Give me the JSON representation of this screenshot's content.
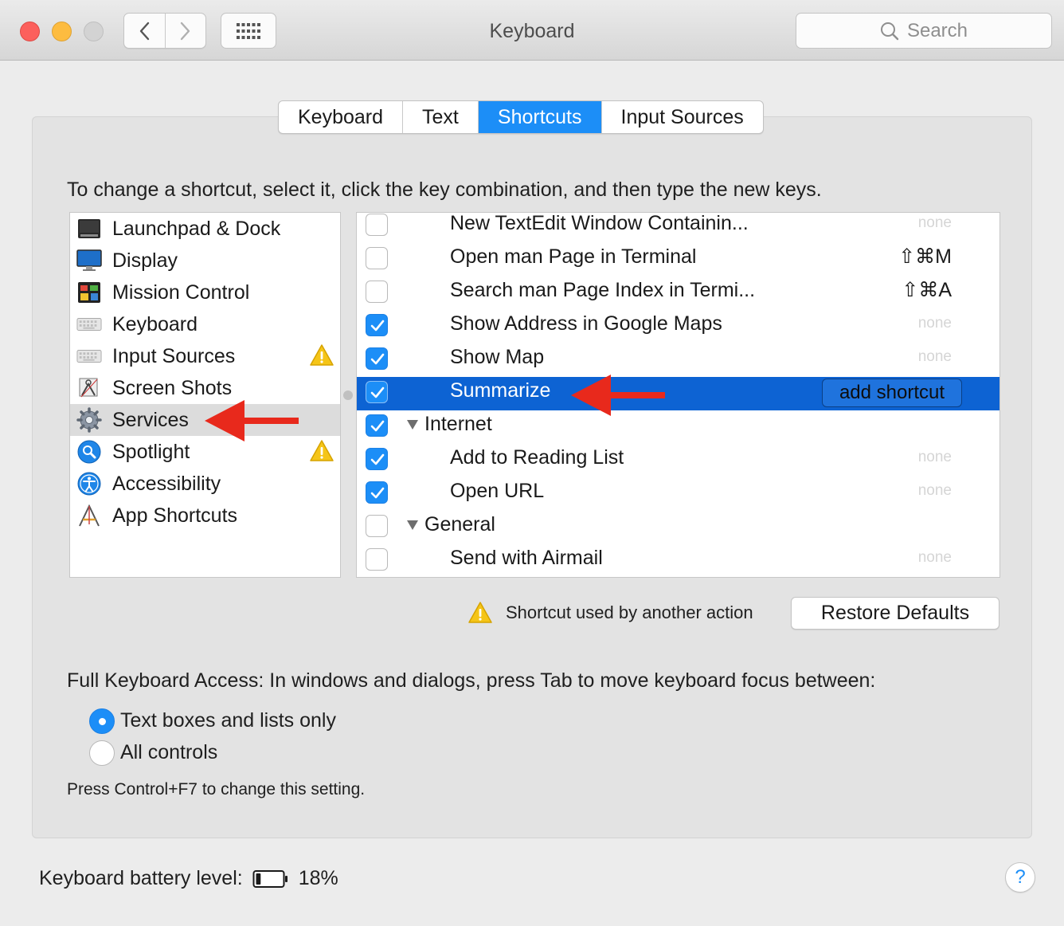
{
  "window": {
    "title": "Keyboard",
    "search_placeholder": "Search"
  },
  "tabs": [
    {
      "label": "Keyboard",
      "active": false
    },
    {
      "label": "Text",
      "active": false
    },
    {
      "label": "Shortcuts",
      "active": true
    },
    {
      "label": "Input Sources",
      "active": false
    }
  ],
  "instructions": "To change a shortcut, select it, click the key combination, and then type the new keys.",
  "categories": [
    {
      "label": "Launchpad & Dock",
      "icon": "launchpad-dock-icon"
    },
    {
      "label": "Display",
      "icon": "display-icon"
    },
    {
      "label": "Mission Control",
      "icon": "mission-control-icon"
    },
    {
      "label": "Keyboard",
      "icon": "keyboard-icon"
    },
    {
      "label": "Input Sources",
      "icon": "input-sources-icon",
      "warning": true
    },
    {
      "label": "Screen Shots",
      "icon": "screen-shots-icon"
    },
    {
      "label": "Services",
      "icon": "gear-icon",
      "selected": true
    },
    {
      "label": "Spotlight",
      "icon": "spotlight-icon",
      "warning": true
    },
    {
      "label": "Accessibility",
      "icon": "accessibility-icon"
    },
    {
      "label": "App Shortcuts",
      "icon": "app-shortcuts-icon"
    }
  ],
  "shortcuts": [
    {
      "label": "New TextEdit Window Containin...",
      "checked": false,
      "keys": "none"
    },
    {
      "label": "Open man Page in Terminal",
      "checked": false,
      "keys": "⇧⌘M"
    },
    {
      "label": "Search man Page Index in Termi...",
      "checked": false,
      "keys": "⇧⌘A"
    },
    {
      "label": "Show Address in Google Maps",
      "checked": true,
      "keys": "none"
    },
    {
      "label": "Show Map",
      "checked": true,
      "keys": "none"
    },
    {
      "label": "Summarize",
      "checked": true,
      "selected": true,
      "keys_button": "add shortcut"
    },
    {
      "label": "Internet",
      "checked": true,
      "group": true
    },
    {
      "label": "Add to Reading List",
      "checked": true,
      "keys": "none"
    },
    {
      "label": "Open URL",
      "checked": true,
      "keys": "none"
    },
    {
      "label": "General",
      "checked": false,
      "group": true
    },
    {
      "label": "Send with Airmail",
      "checked": false,
      "keys": "none"
    }
  ],
  "warning_note": "Shortcut used by another action",
  "restore_defaults": "Restore Defaults",
  "full_keyboard_access": {
    "label": "Full Keyboard Access: In windows and dialogs, press Tab to move keyboard focus between:",
    "options": [
      {
        "label": "Text boxes and lists only",
        "selected": true
      },
      {
        "label": "All controls",
        "selected": false
      }
    ],
    "hint": "Press Control+F7 to change this setting."
  },
  "battery": {
    "label": "Keyboard battery level:",
    "percent": "18%",
    "level": 0.18
  },
  "help": "?",
  "colors": {
    "accent": "#1c8ef7",
    "selection": "#0d63d3",
    "annotation_arrow": "#e8291c"
  }
}
